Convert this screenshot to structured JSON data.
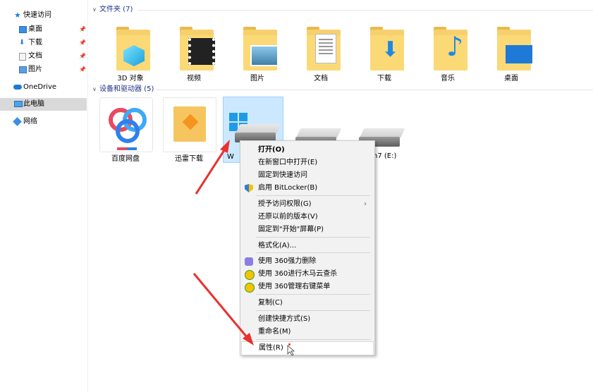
{
  "sidebar": {
    "quick_access": "快速访问",
    "items": [
      {
        "label": "桌面",
        "icon": "desktop-icon"
      },
      {
        "label": "下载",
        "icon": "download-folder-icon"
      },
      {
        "label": "文档",
        "icon": "documents-icon"
      },
      {
        "label": "图片",
        "icon": "pictures-icon"
      }
    ],
    "onedrive": "OneDrive",
    "this_pc": "此电脑",
    "network": "网络"
  },
  "folders_section": {
    "title": "文件夹 (7)",
    "items": [
      {
        "label": "3D 对象"
      },
      {
        "label": "视频"
      },
      {
        "label": "图片"
      },
      {
        "label": "文档"
      },
      {
        "label": "下载"
      },
      {
        "label": "音乐"
      },
      {
        "label": "桌面"
      }
    ]
  },
  "devices_section": {
    "title": "设备和驱动器 (5)",
    "items": [
      {
        "label": "百度网盘"
      },
      {
        "label": "迅雷下载"
      },
      {
        "label": "W"
      },
      {
        "label": ""
      },
      {
        "label": "n7 (E:)"
      }
    ]
  },
  "context_menu": {
    "open": "打开(O)",
    "open_new_window": "在新窗口中打开(E)",
    "pin_quick": "固定到快速访问",
    "bitlocker": "启用 BitLocker(B)",
    "grant_access": "授予访问权限(G)",
    "restore": "还原以前的版本(V)",
    "pin_start": "固定到\"开始\"屏幕(P)",
    "format": "格式化(A)...",
    "force_delete": "使用 360强力删除",
    "trojan_scan": "使用 360进行木马云查杀",
    "manage_menu": "使用 360管理右键菜单",
    "copy": "复制(C)",
    "shortcut": "创建快捷方式(S)",
    "rename": "重命名(M)",
    "properties": "属性(R)"
  },
  "colors": {
    "accent": "#1e3287",
    "selected_bg": "#cce8ff",
    "arrow": "#e8322f"
  }
}
